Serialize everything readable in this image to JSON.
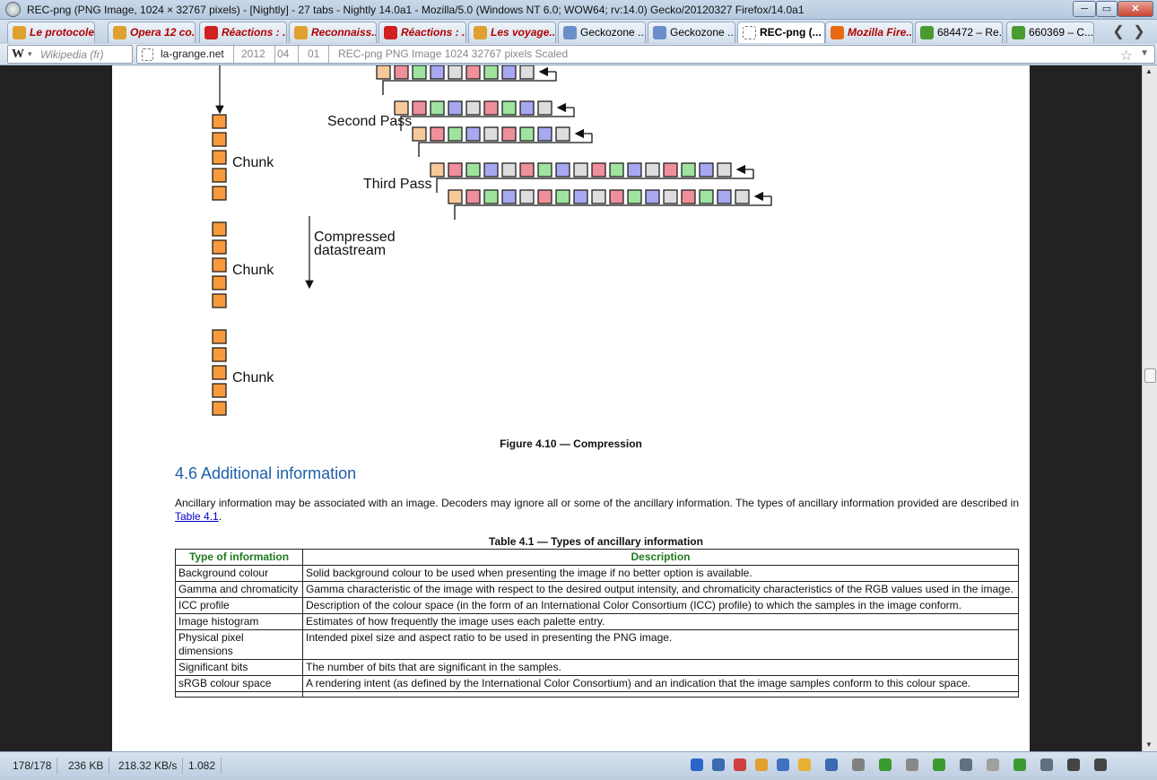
{
  "window": {
    "title": "REC-png (PNG Image, 1024 × 32767 pixels) - [Nightly] - 27 tabs - Nightly 14.0a1 - Mozilla/5.0 (Windows NT 6.0; WOW64; rv:14.0) Gecko/20120327 Firefox/14.0a1",
    "minimize": "─",
    "maximize": "▭",
    "close": "✕"
  },
  "tabs": [
    {
      "label": "Le protocole...",
      "style": "red",
      "icon_color": "#e0a030"
    },
    {
      "label": "Opera 12 co...",
      "style": "red",
      "icon_color": "#e0a030"
    },
    {
      "label": "Réactions : ...",
      "style": "red",
      "icon_color": "#d02020"
    },
    {
      "label": "Reconnaiss...",
      "style": "red",
      "icon_color": "#e0a030"
    },
    {
      "label": "Réactions : ...",
      "style": "red",
      "icon_color": "#d02020"
    },
    {
      "label": "Les voyage...",
      "style": "red",
      "icon_color": "#e0a030"
    },
    {
      "label": "Geckozone ...",
      "style": "normal",
      "icon_color": "#6a8ec8"
    },
    {
      "label": "Geckozone ...",
      "style": "normal",
      "icon_color": "#6a8ec8"
    },
    {
      "label": "REC-png (...",
      "style": "active",
      "icon_color": "#ffffff"
    },
    {
      "label": "Mozilla Fire...",
      "style": "red",
      "icon_color": "#e86a10"
    },
    {
      "label": "684472 – Re...",
      "style": "normal",
      "icon_color": "#4a9a30"
    },
    {
      "label": "660369 – C...",
      "style": "normal",
      "icon_color": "#4a9a30"
    }
  ],
  "tab_nav": {
    "prev": "❮",
    "next": "❯"
  },
  "navbar": {
    "search_placeholder": "Wikipedia (fr)",
    "search_engine_icon": "W",
    "breadcrumbs": [
      "la-grange.net",
      "2012",
      "04",
      "01"
    ],
    "page_title_crumb": "REC-png PNG Image 1024 32767 pixels Scaled",
    "star": "☆",
    "dropdown": "▼"
  },
  "diagram": {
    "labels": {
      "chunk": "Chunk",
      "second_pass": "Second Pass",
      "third_pass": "Third Pass",
      "compressed_line1": "Compressed",
      "compressed_line2": "datastream"
    },
    "colors": {
      "orange": "#f79a3d",
      "peach": "#f7c99a",
      "red": "#ee8f9c",
      "green": "#9fe39f",
      "blue": "#a8a8f0",
      "grey": "#dddddd"
    }
  },
  "figure_caption": "Figure 4.10 — Compression",
  "section": {
    "heading": "4.6 Additional information",
    "paragraph_before_link": "Ancillary information may be associated with an image. Decoders may ignore all or some of the ancillary information. The types of ancillary information provided are described in ",
    "link_text": "Table 4.1",
    "paragraph_after_link": "."
  },
  "table": {
    "caption": "Table 4.1 — Types of ancillary information",
    "headers": [
      "Type of information",
      "Description"
    ],
    "rows": [
      [
        "Background colour",
        "Solid background colour to be used when presenting the image if no better option is available."
      ],
      [
        "Gamma and chromaticity",
        "Gamma characteristic of the image with respect to the desired output intensity, and chromaticity characteristics of the RGB values used in the image."
      ],
      [
        "ICC profile",
        "Description of the colour space (in the form of an International Color Consortium (ICC) profile) to which the samples in the image conform."
      ],
      [
        "Image histogram",
        "Estimates of how frequently the image uses each palette entry."
      ],
      [
        "Physical pixel dimensions",
        "Intended pixel size and aspect ratio to be used in presenting the PNG image."
      ],
      [
        "Significant bits",
        "The number of bits that are significant in the samples."
      ],
      [
        "sRGB colour space",
        "A rendering intent (as defined by the International Color Consortium) and an indication that the image samples conform to this colour space."
      ],
      [
        "",
        ""
      ]
    ]
  },
  "statusbar": {
    "items": [
      "178/178",
      "236 KB",
      "218.32 KB/s",
      "1.082"
    ]
  }
}
